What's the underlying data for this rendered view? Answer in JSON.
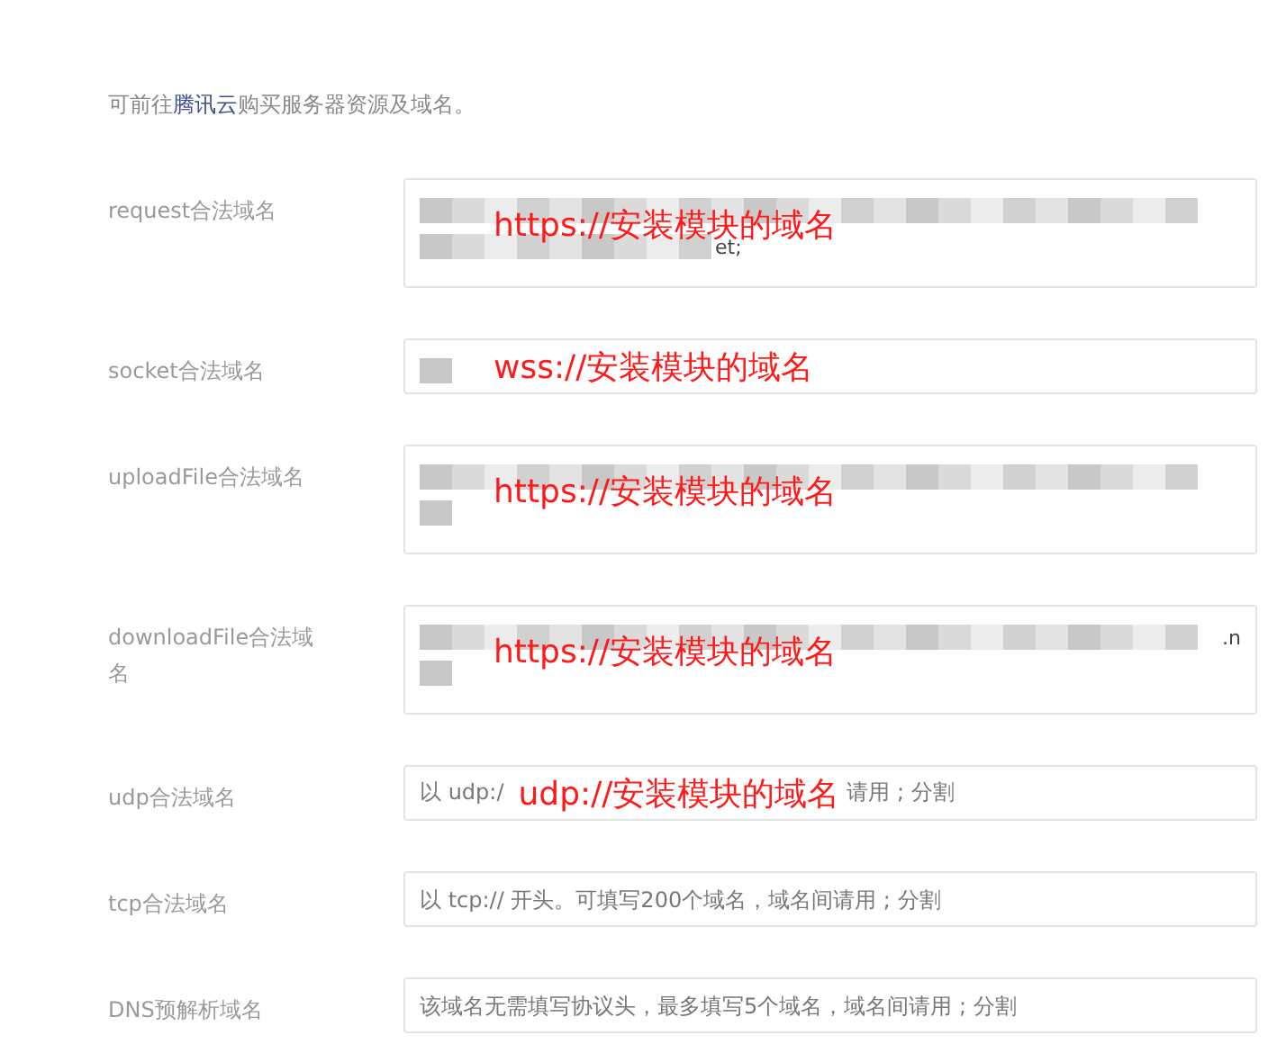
{
  "notice": {
    "prefix": "可前往",
    "link": "腾讯云",
    "suffix": "购买服务器资源及域名。"
  },
  "fields": [
    {
      "label": "request合法域名",
      "kind": "textarea",
      "blurred_lines": [
        {
          "kind": "long"
        },
        {
          "kind": "short",
          "fragment": "et;"
        }
      ],
      "annotation": "https://安装模块的域名"
    },
    {
      "label": "socket合法域名",
      "kind": "input",
      "blurred_lines": [
        {
          "kind": "tiny"
        }
      ],
      "annotation": "wss://安装模块的域名"
    },
    {
      "label": "uploadFile合法域名",
      "kind": "textarea",
      "blurred_lines": [
        {
          "kind": "long"
        },
        {
          "kind": "tiny"
        }
      ],
      "annotation": "https://安装模块的域名"
    },
    {
      "label": "downloadFile合法域名",
      "kind": "textarea",
      "blurred_lines": [
        {
          "kind": "long",
          "fragment": ".n"
        },
        {
          "kind": "tiny"
        }
      ],
      "annotation": "https://安装模块的域名"
    },
    {
      "label": "udp合法域名",
      "kind": "input",
      "placeholder_parts": [
        "以 udp:/",
        "请用 ; 分割"
      ],
      "annotation": "udp://安装模块的域名"
    },
    {
      "label": "tcp合法域名",
      "kind": "input",
      "placeholder": "以 tcp:// 开头。可填写200个域名，域名间请用 ; 分割"
    },
    {
      "label": "DNS预解析域名",
      "kind": "input",
      "placeholder": "该域名无需填写协议头，最多填写5个域名，域名间请用 ; 分割"
    }
  ]
}
